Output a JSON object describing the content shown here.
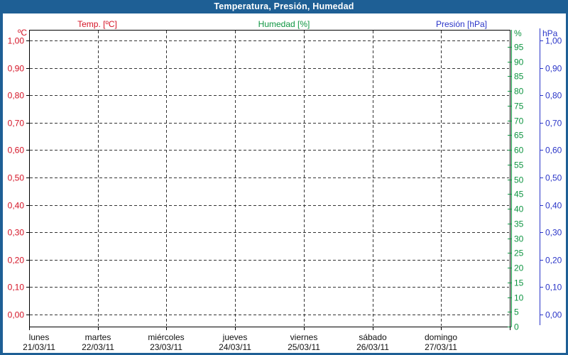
{
  "window": {
    "title": "Temperatura, Presión, Humedad"
  },
  "legend": [
    {
      "label": "Temp. [ºC]",
      "color": "#d41224"
    },
    {
      "label": "Humedad [%]",
      "color": "#0d9440"
    },
    {
      "label": "Presión [hPa]",
      "color": "#2a35c8"
    }
  ],
  "axes": {
    "left_temperature": {
      "unit": "ºC",
      "color": "#d41224",
      "ticks": [
        "1,00",
        "0,90",
        "0,80",
        "0,70",
        "0,60",
        "0,50",
        "0,40",
        "0,30",
        "0,20",
        "0,10",
        "0,00"
      ]
    },
    "right_humidity": {
      "unit": "%",
      "color": "#0d9440",
      "ticks": [
        "95",
        "90",
        "85",
        "80",
        "75",
        "70",
        "65",
        "60",
        "55",
        "50",
        "45",
        "40",
        "35",
        "30",
        "25",
        "20",
        "15",
        "10",
        "5",
        "0"
      ]
    },
    "right_pressure": {
      "unit": "hPa",
      "color": "#2a35c8",
      "ticks": [
        "1,00",
        "0,90",
        "0,80",
        "0,70",
        "0,60",
        "0,50",
        "0,40",
        "0,30",
        "0,20",
        "0,10",
        "0,00"
      ]
    },
    "x_days": [
      {
        "name": "lunes",
        "date": "21/03/11"
      },
      {
        "name": "martes",
        "date": "22/03/11"
      },
      {
        "name": "miércoles",
        "date": "23/03/11"
      },
      {
        "name": "jueves",
        "date": "24/03/11"
      },
      {
        "name": "viernes",
        "date": "25/03/11"
      },
      {
        "name": "sábado",
        "date": "26/03/11"
      },
      {
        "name": "domingo",
        "date": "27/03/11"
      }
    ]
  },
  "colors": {
    "titlebar_bg": "#1e5f95",
    "frame_border": "#1e5f95",
    "plot_background": "#ffffff",
    "plot_border": "#000000",
    "gridline": "#333333",
    "day_label": "#111111"
  },
  "chart_data": {
    "type": "line",
    "title": "Temperatura, Presión, Humedad",
    "grid": true,
    "legend_position": "top",
    "x": {
      "categories": [
        "lunes 21/03/11",
        "martes 22/03/11",
        "miércoles 23/03/11",
        "jueves 24/03/11",
        "viernes 25/03/11",
        "sábado 26/03/11",
        "domingo 27/03/11"
      ],
      "start_date": "21/03/11",
      "end_date": "27/03/11"
    },
    "series": [
      {
        "name": "Temp. [ºC]",
        "color": "#d41224",
        "axis": "left",
        "axis_range": [
          0.0,
          1.0
        ],
        "tick_step": 0.1,
        "values": []
      },
      {
        "name": "Humedad [%]",
        "color": "#0d9440",
        "axis": "right-inner",
        "axis_range": [
          0,
          100
        ],
        "tick_step": 5,
        "values": []
      },
      {
        "name": "Presión [hPa]",
        "color": "#2a35c8",
        "axis": "right-outer",
        "axis_range": [
          0.0,
          1.0
        ],
        "tick_step": 0.1,
        "values": []
      }
    ]
  }
}
